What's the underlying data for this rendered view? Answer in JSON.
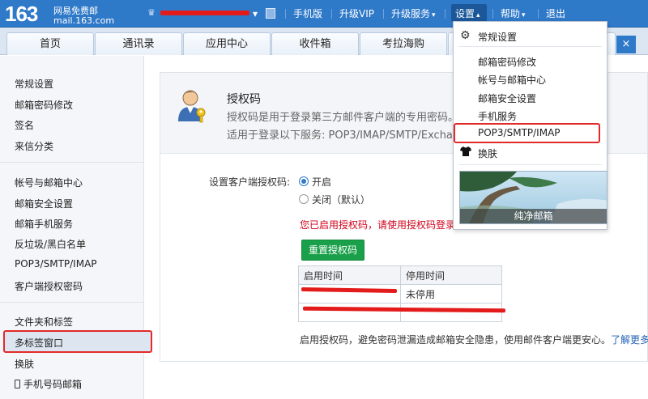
{
  "topbar": {
    "logo_big": "163",
    "logo_cn": "网易免费邮",
    "logo_url": "mail.163.com",
    "links": [
      "手机版",
      "升级VIP",
      "升级服务",
      "设置",
      "帮助",
      "退出"
    ],
    "colors": {
      "bar": "#2f79c9",
      "redaction": "#e31b1b"
    }
  },
  "tabs": [
    "首页",
    "通讯录",
    "应用中心",
    "收件箱",
    "考拉海购"
  ],
  "tab_close": "×",
  "sidebar": {
    "items": [
      "常规设置",
      "邮箱密码修改",
      "签名",
      "来信分类",
      "帐号与邮箱中心",
      "邮箱安全设置",
      "邮箱手机服务",
      "反垃圾/黑白名单",
      "POP3/SMTP/IMAP",
      "客户端授权密码",
      "文件夹和标签",
      "多标签窗口",
      "换肤",
      "手机号码邮箱"
    ],
    "active": "客户端授权密码"
  },
  "main": {
    "title": "授权码",
    "desc1": "授权码是用于登录第三方邮件客户端的专用密码。",
    "desc2": "适用于登录以下服务: POP3/IMAP/SMTP/Exchan",
    "setting_label": "设置客户端授权码:",
    "radio_on": "开启",
    "radio_off": "关闭（默认）",
    "notice": "您已启用授权码，请使用授权码登录第三",
    "reset_button": "重置授权码",
    "table": {
      "headers": [
        "启用时间",
        "停用时间"
      ],
      "rows": [
        [
          "",
          "未停用"
        ],
        [
          "",
          ""
        ]
      ]
    },
    "footer_text": "启用授权码，避免密码泄漏造成邮箱安全隐患，使用邮件客户端更安心。",
    "footer_link": "了解更多>>"
  },
  "dropdown": {
    "general": "常规设置",
    "items": [
      "邮箱密码修改",
      "帐号与邮箱中心",
      "邮箱安全设置",
      "手机服务",
      "POP3/SMTP/IMAP"
    ],
    "skin": "换肤",
    "theme_caption": "纯净邮箱",
    "highlighted": "POP3/SMTP/IMAP"
  }
}
